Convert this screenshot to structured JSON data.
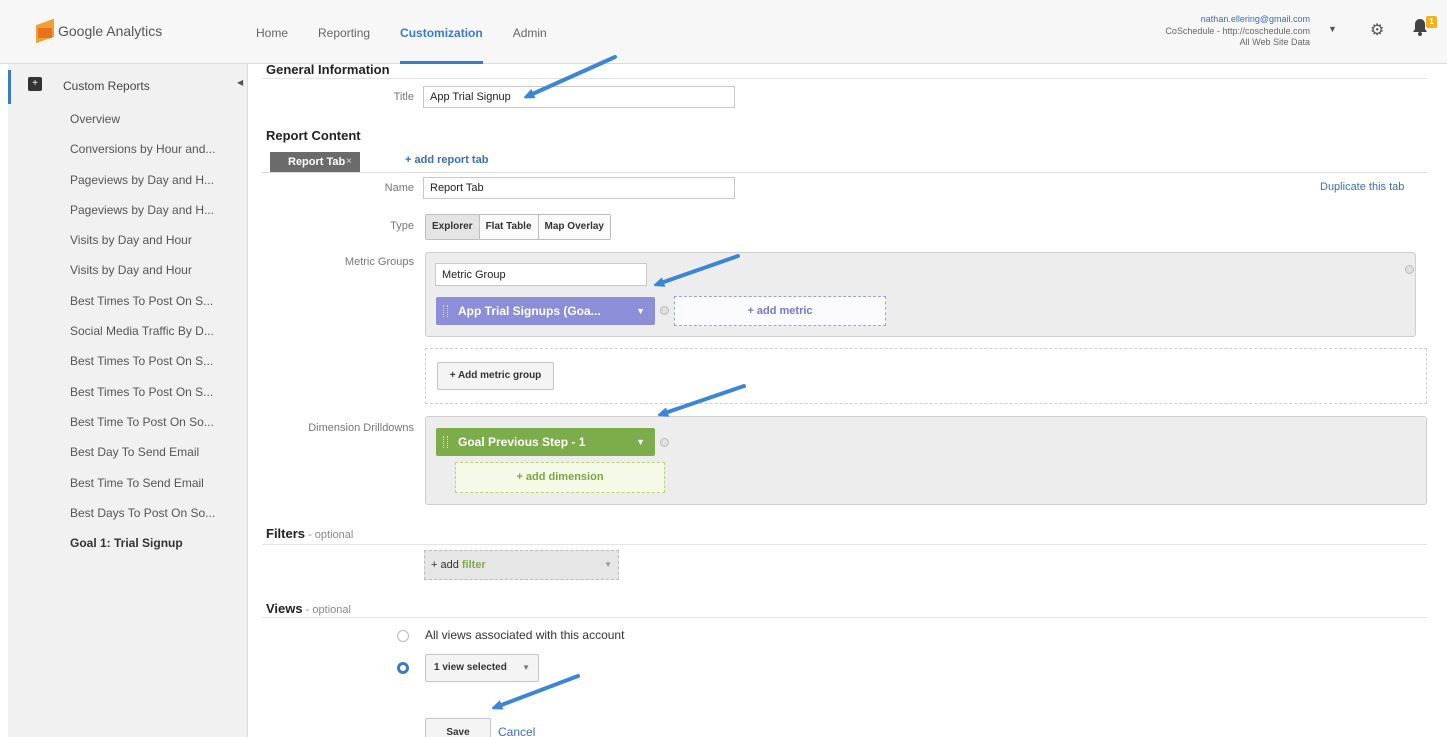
{
  "header": {
    "logo_text": "Google Analytics",
    "nav": [
      "Home",
      "Reporting",
      "Customization",
      "Admin"
    ],
    "active_nav": "Customization",
    "account_email": "nathan.ellering@gmail.com",
    "account_property": "CoSchedule - http://coschedule.com",
    "account_view": "All Web Site Data",
    "notification_count": "1"
  },
  "sidebar": {
    "section_label": "Custom Reports",
    "items": [
      "Overview",
      "Conversions by Hour and...",
      "Pageviews by Day and H...",
      "Pageviews by Day and H...",
      "Visits by Day and Hour",
      "Visits by Day and Hour",
      "Best Times To Post On S...",
      "Social Media Traffic By D...",
      "Best Times To Post On S...",
      "Best Times To Post On S...",
      "Best Time To Post On So...",
      "Best Day To Send Email",
      "Best Time To Send Email",
      "Best Days To Post On So...",
      "Goal 1: Trial Signup"
    ],
    "active_item": "Goal 1: Trial Signup"
  },
  "form": {
    "general_title": "General Information",
    "title_label": "Title",
    "title_value": "App Trial Signup",
    "report_content_title": "Report Content",
    "tab_chip": "Report Tab",
    "tab_close": "×",
    "add_report_tab": "+ add report tab",
    "name_label": "Name",
    "name_value": "Report Tab",
    "duplicate_tab": "Duplicate this tab",
    "type_label": "Type",
    "type_options": [
      "Explorer",
      "Flat Table",
      "Map Overlay"
    ],
    "metric_groups_label": "Metric Groups",
    "metric_group_name": "Metric Group",
    "metric_pill": "App Trial Signups (Goa...",
    "add_metric": "+ add metric",
    "add_metric_group": "+ Add metric group",
    "dimension_label": "Dimension Drilldowns",
    "dimension_pill": "Goal Previous Step - 1",
    "add_dimension": "+ add dimension",
    "filters_title": "Filters",
    "filters_optional": " - optional",
    "add_filter_prefix": "+ add ",
    "add_filter_word": "filter",
    "views_title": "Views",
    "views_optional": " - optional",
    "view_option_all": "All views associated with this account",
    "view_selected": "1 view selected",
    "save_label": "Save",
    "cancel_label": "Cancel"
  },
  "icons": {
    "caret": "▼",
    "gear": "⚙",
    "bell": "🔔",
    "collapse": "◀"
  },
  "colors": {
    "accent": "#3a7bc8",
    "metric_pill": "#8c8fd8",
    "dimension_pill": "#7dac4a",
    "annotation_arrow": "#3b86d6"
  }
}
